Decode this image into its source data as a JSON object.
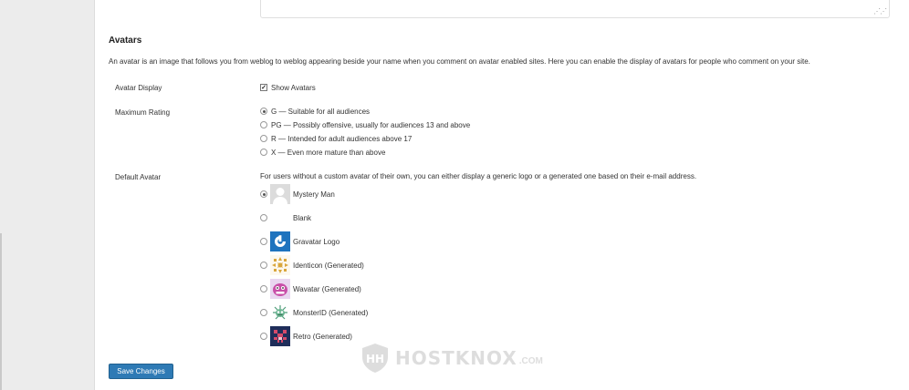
{
  "section": {
    "title": "Avatars",
    "description": "An avatar is an image that follows you from weblog to weblog appearing beside your name when you comment on avatar enabled sites. Here you can enable the display of avatars for people who comment on your site."
  },
  "avatar_display": {
    "label": "Avatar Display",
    "checkbox_label": "Show Avatars",
    "checked": true
  },
  "maximum_rating": {
    "label": "Maximum Rating",
    "options": [
      {
        "label": "G — Suitable for all audiences",
        "checked": true
      },
      {
        "label": "PG — Possibly offensive, usually for audiences 13 and above",
        "checked": false
      },
      {
        "label": "R — Intended for adult audiences above 17",
        "checked": false
      },
      {
        "label": "X — Even more mature than above",
        "checked": false
      }
    ]
  },
  "default_avatar": {
    "label": "Default Avatar",
    "help": "For users without a custom avatar of their own, you can either display a generic logo or a generated one based on their e-mail address.",
    "options": [
      {
        "label": "Mystery Man",
        "checked": true,
        "icon": "mystery-man-icon"
      },
      {
        "label": "Blank",
        "checked": false,
        "icon": "blank-icon"
      },
      {
        "label": "Gravatar Logo",
        "checked": false,
        "icon": "gravatar-logo-icon"
      },
      {
        "label": "Identicon (Generated)",
        "checked": false,
        "icon": "identicon-icon"
      },
      {
        "label": "Wavatar (Generated)",
        "checked": false,
        "icon": "wavatar-icon"
      },
      {
        "label": "MonsterID (Generated)",
        "checked": false,
        "icon": "monsterid-icon"
      },
      {
        "label": "Retro (Generated)",
        "checked": false,
        "icon": "retro-icon"
      }
    ]
  },
  "save_button": {
    "label": "Save Changes"
  },
  "watermark": {
    "text": "HOSTKNOX",
    "suffix": ".COM"
  },
  "colors": {
    "button": "#2e7ab5",
    "sidebar": "#ececec"
  }
}
